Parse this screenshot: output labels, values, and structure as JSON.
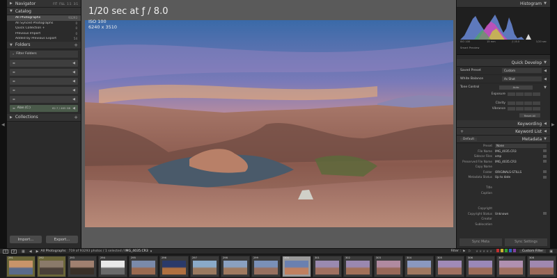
{
  "navigator": {
    "title": "Navigator",
    "zoom_levels": [
      "FIT",
      "FILL",
      "1:1",
      "3:1"
    ]
  },
  "catalog": {
    "title": "Catalog",
    "items": [
      {
        "label": "All Photographs",
        "count": "93293",
        "selected": true
      },
      {
        "label": "All Synced Photographs",
        "count": "0"
      },
      {
        "label": "Quick Collection +",
        "count": "0"
      },
      {
        "label": "Previous Import",
        "count": "0"
      },
      {
        "label": "Added by Previous Export",
        "count": "54"
      }
    ]
  },
  "folders": {
    "title": "Folders",
    "filter_label": "Filter Folders",
    "drive_label": "Alan (C:)",
    "drive_size": "62.7 / 465 GB"
  },
  "collections": {
    "title": "Collections"
  },
  "left_buttons": {
    "import": "Import...",
    "export": "Export..."
  },
  "overlay": {
    "exposure": "1/20 sec at ƒ / 8.0",
    "iso": "ISO 100",
    "dimensions": "6240 x 3510"
  },
  "histogram": {
    "title": "Histogram",
    "stats": [
      "ISO 100",
      "15 mm",
      "ƒ / 8.0",
      "1/20 sec"
    ],
    "smart_preview": "Smart Preview"
  },
  "quick_develop": {
    "title": "Quick Develop",
    "saved_preset_label": "Saved Preset",
    "saved_preset_value": "Custom",
    "white_balance_label": "White Balance",
    "white_balance_value": "As Shot",
    "tone_control_label": "Tone Control",
    "auto_label": "Auto",
    "exposure_label": "Exposure",
    "clarity_label": "Clarity",
    "vibrance_label": "Vibrance",
    "reset_label": "Reset All"
  },
  "keywording": {
    "title": "Keywording"
  },
  "keyword_list": {
    "title": "Keyword List"
  },
  "metadata": {
    "title": "Metadata",
    "preset_select": "Default",
    "rows": [
      {
        "label": "Preset",
        "value": "None",
        "box": true
      },
      {
        "label": "File Name",
        "value": "IMG_4035.CR3",
        "box": false
      },
      {
        "label": "Sidecar Files",
        "value": "xmp",
        "box": false
      },
      {
        "label": "Preserved File Name",
        "value": "IMG_4035.CR3",
        "box": false
      },
      {
        "label": "Copy Name",
        "value": "",
        "box": false
      },
      {
        "label": "Folder",
        "value": "ORIGINALS-STILLS",
        "box": false
      },
      {
        "label": "Metadata Status",
        "value": "Up to date",
        "box": false
      },
      {
        "label": "",
        "value": "",
        "box": false
      },
      {
        "label": "Title",
        "value": "",
        "box": false
      },
      {
        "label": "Caption",
        "value": "",
        "box": false
      },
      {
        "label": "",
        "value": "",
        "box": false
      },
      {
        "label": "",
        "value": "",
        "box": false
      },
      {
        "label": "Copyright",
        "value": "",
        "box": false
      },
      {
        "label": "Copyright Status",
        "value": "Unknown",
        "box": false
      },
      {
        "label": "Creator",
        "value": "",
        "box": false
      },
      {
        "label": "Sublocation",
        "value": "",
        "box": false
      }
    ]
  },
  "right_buttons": {
    "sync_meta": "Sync Meta",
    "sync_settings": "Sync Settings"
  },
  "filmstrip_toolbar": {
    "screen1": "1",
    "screen2": "2",
    "source": "All Photographs",
    "info_count": "719 of 93293 photos / 1 selected /",
    "info_file": "IMG_4035.CR3",
    "filter_label": "Filter :",
    "custom_filter": "Custom Filter",
    "swatch_colors": [
      "#c03030",
      "#c8b030",
      "#30a030",
      "#3060c0",
      "#8040a0"
    ]
  },
  "filmstrip": {
    "thumbs": [
      {
        "num": "291",
        "style": "yellow",
        "colors": [
          "#c8946a",
          "#5a6a8a"
        ]
      },
      {
        "num": "292",
        "style": "yellow",
        "colors": [
          "#8a7a6a",
          "#4a4038"
        ]
      },
      {
        "num": "293",
        "style": "",
        "colors": [
          "#a08070",
          "#3a3028"
        ]
      },
      {
        "num": "294",
        "style": "",
        "colors": [
          "#e8e8e8",
          "#6a6a6a"
        ]
      },
      {
        "num": "295",
        "style": "",
        "colors": [
          "#7a8aaa",
          "#9a6a50"
        ]
      },
      {
        "num": "296",
        "style": "",
        "colors": [
          "#2a3a6a",
          "#b07040"
        ]
      },
      {
        "num": "297",
        "style": "",
        "colors": [
          "#8aaac8",
          "#9a7a60"
        ]
      },
      {
        "num": "298",
        "style": "",
        "colors": [
          "#8aa0c0",
          "#a07a60"
        ]
      },
      {
        "num": "299",
        "style": "",
        "colors": [
          "#7a90b8",
          "#987060"
        ]
      },
      {
        "num": "300",
        "style": "sel",
        "colors": [
          "#6a80b0",
          "#c08060"
        ]
      },
      {
        "num": "301",
        "style": "",
        "colors": [
          "#9a8ab0",
          "#a07060"
        ]
      },
      {
        "num": "302",
        "style": "",
        "colors": [
          "#9a88b0",
          "#a27058"
        ]
      },
      {
        "num": "303",
        "style": "",
        "colors": [
          "#b08aa0",
          "#986858"
        ]
      },
      {
        "num": "304",
        "style": "",
        "colors": [
          "#8a98c0",
          "#a07860"
        ]
      },
      {
        "num": "305",
        "style": "",
        "colors": [
          "#a08ab8",
          "#a07060"
        ]
      },
      {
        "num": "306",
        "style": "",
        "colors": [
          "#9a88b8",
          "#9c6c58"
        ]
      },
      {
        "num": "307",
        "style": "",
        "colors": [
          "#b090b0",
          "#a07060"
        ]
      },
      {
        "num": "308",
        "style": "",
        "colors": [
          "#a088b0",
          "#9a6858"
        ]
      }
    ]
  }
}
